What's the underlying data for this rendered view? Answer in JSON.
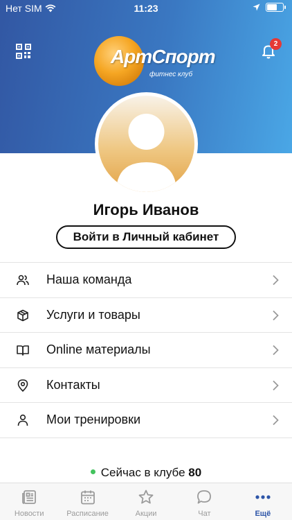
{
  "status_bar": {
    "carrier": "Нет SIM",
    "time": "11:23",
    "battery_level": 0.6
  },
  "header": {
    "logo": {
      "brand": "АртСпорт",
      "tagline": "фитнес клуб"
    },
    "notifications_count": "2"
  },
  "profile": {
    "name": "Игорь Иванов",
    "login_button": "Войти в Личный кабинет"
  },
  "menu": [
    {
      "label": "Наша команда",
      "icon": "team-icon"
    },
    {
      "label": "Услуги и товары",
      "icon": "box-icon"
    },
    {
      "label": "Online материалы",
      "icon": "book-icon"
    },
    {
      "label": "Контакты",
      "icon": "location-pin-icon"
    },
    {
      "label": "Мои тренировки",
      "icon": "person-icon"
    }
  ],
  "club_status": {
    "label": "Сейчас в клубе",
    "count": "80",
    "status_color": "#43c35e"
  },
  "tabbar": [
    {
      "label": "Новости",
      "icon": "news-icon",
      "active": false
    },
    {
      "label": "Расписание",
      "icon": "calendar-icon",
      "active": false
    },
    {
      "label": "Акции",
      "icon": "star-icon",
      "active": false
    },
    {
      "label": "Чат",
      "icon": "chat-icon",
      "active": false
    },
    {
      "label": "Ещё",
      "icon": "more-icon",
      "active": true
    }
  ],
  "colors": {
    "header_start": "#3257a3",
    "header_end": "#4aa7e6",
    "accent": "#2d55a8",
    "badge": "#e53935"
  }
}
